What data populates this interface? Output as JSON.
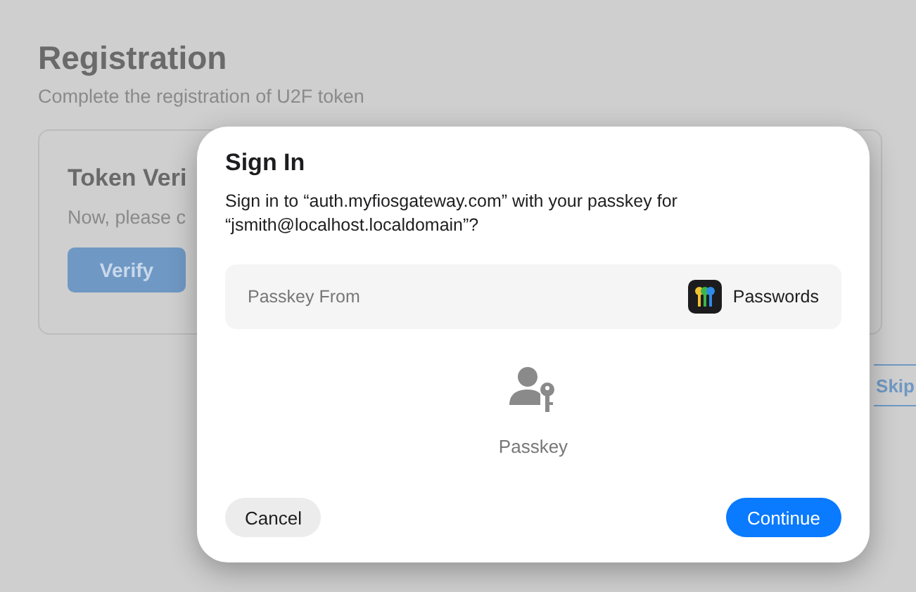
{
  "page": {
    "title": "Registration",
    "subtitle": "Complete the registration of U2F token"
  },
  "card": {
    "title": "Token Veri",
    "text": "Now, please c",
    "button": "Verify"
  },
  "skip_button": "Skip",
  "dialog": {
    "title": "Sign In",
    "message": "Sign in to “auth.myfiosgateway.com” with your passkey for “jsmith@localhost.localdomain”?",
    "source_label": "Passkey From",
    "source_app": "Passwords",
    "credential_label": "Passkey",
    "buttons": [
      {
        "label": "Cancel",
        "kind": "secondary"
      },
      {
        "label": "Continue",
        "kind": "primary"
      }
    ]
  }
}
